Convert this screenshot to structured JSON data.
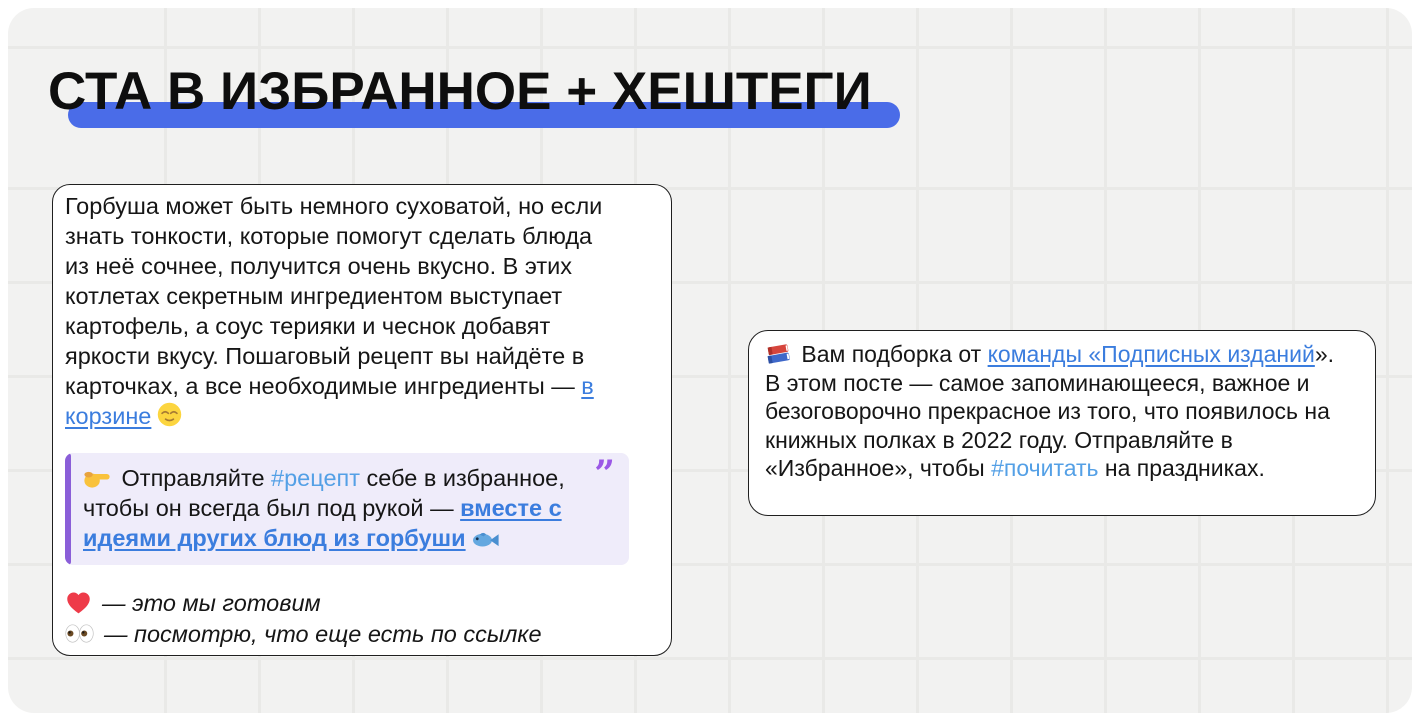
{
  "title": {
    "text": "СТА В ИЗБРАННОЕ + ХЕШТЕГИ"
  },
  "colors": {
    "accent_bar": "#4a6ce8",
    "link_blue": "#3b7dde",
    "hashtag_blue": "#54a0e6",
    "quote_bg": "#efecfa",
    "quote_bar_purple": "#8a5ed8",
    "quote_mark_purple": "#9b57e6",
    "panel_bg": "#f2f2f1",
    "grid_line": "#e9e9e7",
    "heart_red": "#ee3b49"
  },
  "left_card": {
    "paragraph": {
      "text_1": "Горбуша может быть немного суховатой, но если знать тонкости, которые помогут сделать блюда из неё сочнее, получится очень вкусно. В этих котлетах секретным ингредиентом выступает картофель, а соус терияки и чеснок добавят яркости вкусу. Пошаговый рецепт вы найдёте в карточках, а все необходимые ингредиенты — ",
      "link": "в корзине",
      "emoji_relieved": "😌"
    },
    "quote": {
      "emoji_point_right": "👉",
      "text_1": " Отправляйте ",
      "hashtag": "#рецепт",
      "text_2": " себе в избранное, чтобы он всегда был под рукой — ",
      "link": "вместе с идеями других блюд из горбуши",
      "emoji_fish": "🐟",
      "quote_mark": "”"
    },
    "reactions": [
      {
        "emoji": "❤️",
        "text": "— это мы готовим"
      },
      {
        "emoji": "👀",
        "text": "— посмотрю, что еще есть по ссылке"
      }
    ]
  },
  "right_card": {
    "emoji_books": "📚",
    "text_1": " Вам подборка от ",
    "link": "команды «Подписных изданий",
    "text_2": "». В этом посте — самое запоминающееся, важное и безоговорочно прекрасное из того, что появилось на книжных полках в 2022 году. Отправляйте в «Избранное», чтобы ",
    "hashtag": "#почитать",
    "text_3": " на праздниках."
  }
}
